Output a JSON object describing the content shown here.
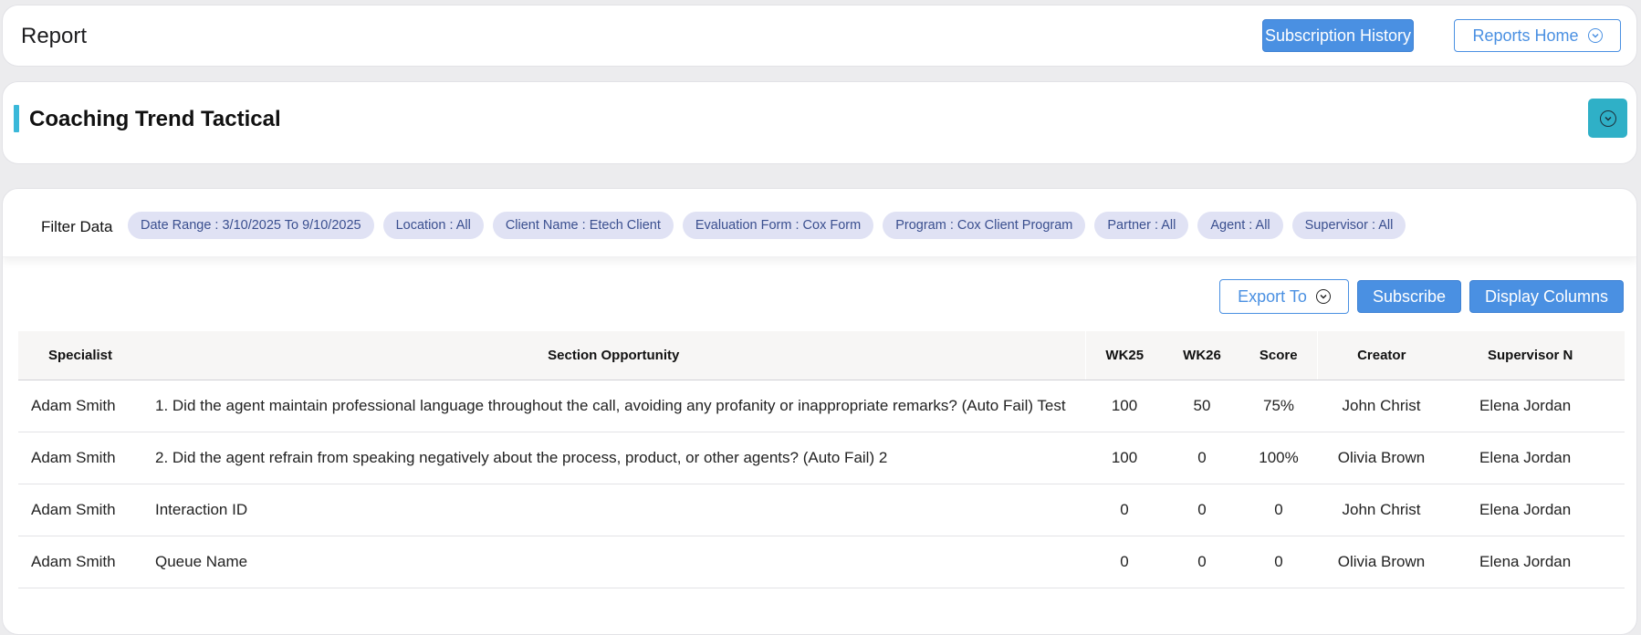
{
  "header": {
    "title": "Report",
    "subscription_history_label": "Subscription History",
    "reports_home_label": "Reports Home"
  },
  "report": {
    "title": "Coaching Trend Tactical"
  },
  "filters": {
    "label": "Filter Data",
    "chips": [
      "Date Range : 3/10/2025 To 9/10/2025",
      "Location : All",
      "Client Name : Etech Client",
      "Evaluation Form : Cox Form",
      "Program : Cox Client Program",
      "Partner : All",
      "Agent : All",
      "Supervisor : All"
    ]
  },
  "toolbar": {
    "export_label": "Export To",
    "subscribe_label": "Subscribe",
    "display_columns_label": "Display Columns"
  },
  "table": {
    "columns": [
      "Specialist",
      "Section Opportunity",
      "WK25",
      "WK26",
      "Score",
      "Creator",
      "Supervisor N"
    ],
    "rows": [
      [
        "Adam Smith",
        "1. Did the agent maintain professional language throughout the call, avoiding any profanity or inappropriate remarks? (Auto Fail) Test",
        "100",
        "50",
        "75%",
        "John Christ",
        "Elena Jordan"
      ],
      [
        "Adam Smith",
        "2. Did the agent refrain from speaking negatively about the process, product, or other agents? (Auto Fail) 2",
        "100",
        "0",
        "100%",
        "Olivia Brown",
        "Elena Jordan"
      ],
      [
        "Adam Smith",
        "Interaction ID",
        "0",
        "0",
        "0",
        "John Christ",
        "Elena Jordan"
      ],
      [
        "Adam Smith",
        "Queue Name",
        "0",
        "0",
        "0",
        "Olivia Brown",
        "Elena Jordan"
      ]
    ]
  },
  "colors": {
    "primary": "#4a90e2",
    "accent": "#3ab8d9",
    "chip_bg": "#e0e2f4",
    "chip_text": "#3a4f8f"
  }
}
